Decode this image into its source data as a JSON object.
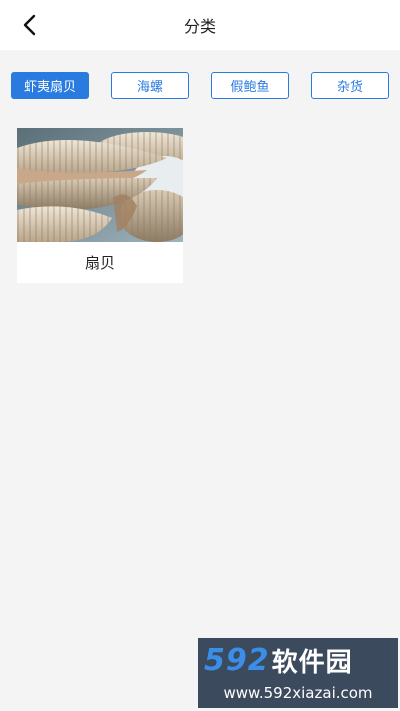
{
  "header": {
    "title": "分类",
    "back_icon": "chevron-left-icon"
  },
  "tabs": [
    {
      "label": "虾夷扇贝",
      "active": true
    },
    {
      "label": "海螺",
      "active": false
    },
    {
      "label": "假鲍鱼",
      "active": false
    },
    {
      "label": "杂货",
      "active": false
    }
  ],
  "products": [
    {
      "name": "扇贝",
      "image": "scallop-photo"
    }
  ],
  "watermark": {
    "number": "592",
    "brand": "软件园",
    "url": "www.592xiazai.com"
  },
  "colors": {
    "accent": "#2a7be0",
    "background": "#f4f4f4",
    "header_bg": "#ffffff"
  }
}
